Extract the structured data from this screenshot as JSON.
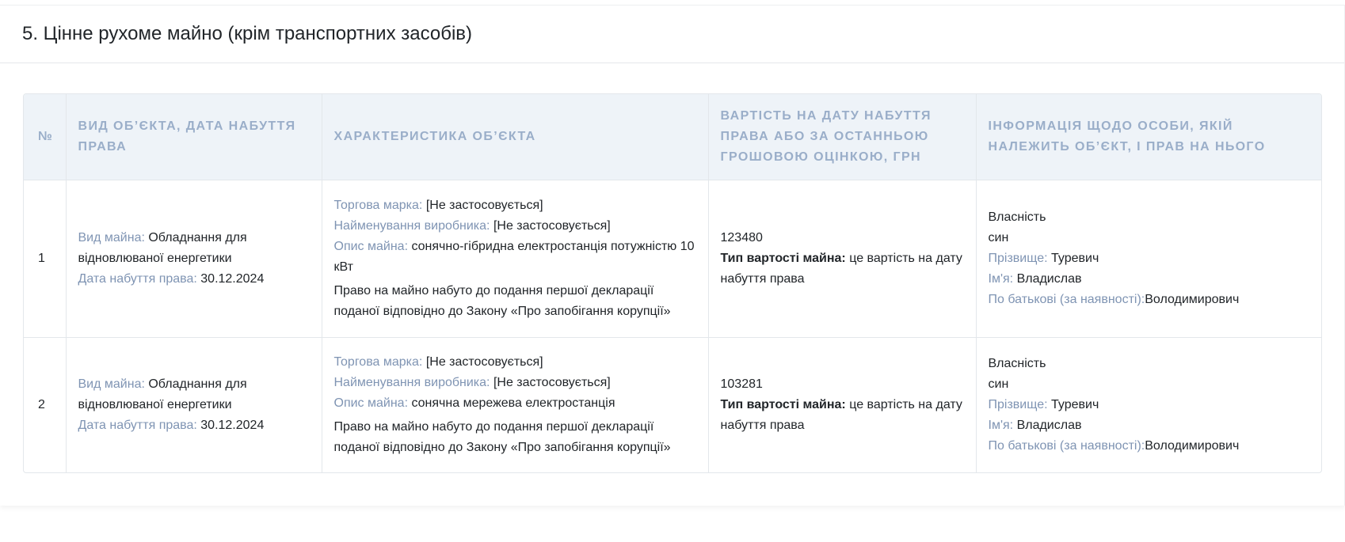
{
  "section": {
    "title": "5. Цінне рухоме майно (крім транспортних засобів)"
  },
  "table": {
    "headers": {
      "num": "№",
      "type": "Вид об’єкта, дата набуття права",
      "description": "Характеристика об’єкта",
      "value": "Вартість на дату набуття права або за останньою грошовою оцінкою, грн",
      "owner": "Інформація щодо особи, якій належить об’єкт, і прав на нього"
    },
    "labels": {
      "property_type": "Вид майна:",
      "acquisition_date": "Дата набуття права:",
      "brand": "Торгова марка:",
      "manufacturer": "Найменування виробника:",
      "property_description": "Опис майна:",
      "value_type": "Тип вартості майна:",
      "surname": "Прізвище:",
      "first_name": "Ім'я:",
      "patronymic": "По батькові (за наявності):"
    },
    "rows": [
      {
        "num": "1",
        "property_type": "Обладнання для відновлюваної енергетики",
        "acquisition_date": "30.12.2024",
        "brand": "[Не застосовується]",
        "manufacturer": "[Не застосовується]",
        "property_description": "сонячно-гібридна електростанція потужністю 10 кВт",
        "acquisition_note": "Право на майно набуто до подання першої декларації поданої відповідно до Закону «Про запобігання корупції»",
        "value": "123480",
        "value_type": "це вартість на дату набуття права",
        "ownership": "Власність",
        "relation": "син",
        "surname": "Туревич",
        "first_name": "Владислав",
        "patronymic": "Володимирович"
      },
      {
        "num": "2",
        "property_type": "Обладнання для відновлюваної енергетики",
        "acquisition_date": "30.12.2024",
        "brand": "[Не застосовується]",
        "manufacturer": "[Не застосовується]",
        "property_description": "сонячна мережева електростанція",
        "acquisition_note": "Право на майно набуто до подання першої декларації поданої відповідно до Закону «Про запобігання корупції»",
        "value": "103281",
        "value_type": "це вартість на дату набуття права",
        "ownership": "Власність",
        "relation": "син",
        "surname": "Туревич",
        "first_name": "Владислав",
        "patronymic": "Володимирович"
      }
    ]
  }
}
